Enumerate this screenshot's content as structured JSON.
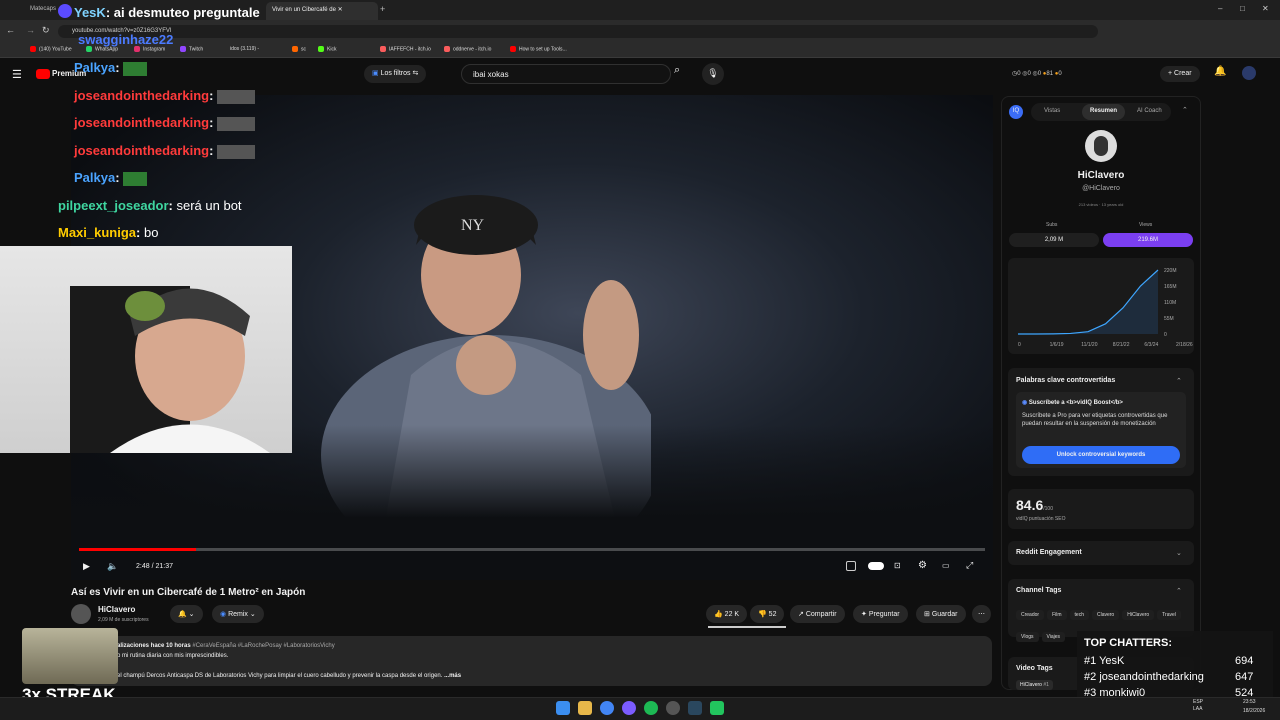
{
  "browser": {
    "tabs": [
      "Matecaps",
      "Vivir en un Cibercafé de"
    ],
    "url": "youtube.com/watch?v=z0Z16G3YFVI",
    "bookmarks": [
      "(140) YouTube",
      "WhatsApp",
      "Instagram",
      "Twitch",
      "idos (3.119) -",
      "sc",
      "Kick",
      "IAFFEFCH - itch.io",
      "oddnerve - itch.io",
      "How to set up Tools..."
    ]
  },
  "youtube": {
    "logo_label": "Premium",
    "filter_label": "Los filtros",
    "search_value": "ibai xokas",
    "create_label": "Crear",
    "header_stats": [
      "0",
      "0",
      "0",
      "81",
      "0"
    ]
  },
  "player": {
    "time": "2:48 / 21:37",
    "progress": 0.129
  },
  "video": {
    "title": "Así es Vivir en un Cibercafé de 1 Metro² en Japón",
    "channel": "HiClavero",
    "subs": "2,09 M de suscriptores",
    "remix_label": "Remix",
    "likes": "22 K",
    "dislikes": "52",
    "share_label": "Compartir",
    "ask_label": "Preguntar",
    "save_label": "Guardar",
    "desc_meta": "alizaciones  hace 10 horas",
    "desc_tags": "#CeraVeEspaña #LaRochePosay #LaboratoriosVichy",
    "desc_line1": "o mi rutina diaria con mis imprescindibles.",
    "desc_line2": "el champú Dercos Anticaspa DS de Laboratorios Vichy para limpiar el cuero cabelludo y prevenir la caspa desde el origen.",
    "desc_more": "...más"
  },
  "chat": [
    {
      "user": "YesK",
      "msg": "ai desmuteo preguntale",
      "color": "#7fd3ff"
    },
    {
      "user": "swagginhaze22",
      "msg": "",
      "color": "#4b7bff"
    },
    {
      "user": "Palkya",
      "msg": "",
      "color": "#4aa3ff"
    },
    {
      "user": "joseandointhedarking",
      "msg": "",
      "color": "#ff3b3b"
    },
    {
      "user": "joseandointhedarking",
      "msg": "",
      "color": "#ff3b3b"
    },
    {
      "user": "joseandointhedarking",
      "msg": "",
      "color": "#ff3b3b"
    },
    {
      "user": "Palkya",
      "msg": "",
      "color": "#4aa3ff"
    },
    {
      "user": "pilpeext_joseador",
      "msg": "será un bot",
      "color": "#3fd6a0"
    },
    {
      "user": "Maxi_kuniga",
      "msg": "bo",
      "color": "#ffcc00"
    }
  ],
  "streak": "3x STREAK",
  "top_chatters": {
    "title": "TOP CHATTERS:",
    "rows": [
      {
        "rank": "#1",
        "name": "YesK",
        "count": "694"
      },
      {
        "rank": "#2",
        "name": "joseandointhedarking",
        "count": "647"
      },
      {
        "rank": "#3",
        "name": "monkiwi0",
        "count": "524"
      }
    ]
  },
  "vidiq": {
    "tabs": [
      "Vistas",
      "Resumen",
      "AI Coach"
    ],
    "channel_name": "HiClavero",
    "handle": "@HiClavero",
    "meta": [
      "213 videos",
      "13 years old"
    ],
    "subs_label": "Subs",
    "views_label": "Views",
    "subs_value": "2,09 M",
    "views_value": "219.6M",
    "chart_data": {
      "type": "area",
      "x": [
        "0",
        "1/6/19",
        "11/1/20",
        "8/21/22",
        "6/3/24",
        "2/18/26"
      ],
      "yticks": [
        "220M",
        "165M",
        "110M",
        "55M",
        "0"
      ],
      "values": [
        0,
        0,
        0.5,
        2,
        8,
        35,
        90,
        165,
        220
      ],
      "ylim": [
        0,
        220
      ]
    },
    "controversial_title": "Palabras clave controvertidas",
    "boost_title": "Suscríbete a <b>vidIQ Boost</b>",
    "boost_text": "Suscríbete a Pro para ver etiquetas controvertidas que puedan resultar en la suspensión de monetización",
    "unlock_label": "Unlock controversial keywords",
    "seo_score": "84.6",
    "seo_max": "/100",
    "seo_label": "vidIQ puntuación SEO",
    "reddit_label": "Reddit Engagement",
    "channel_tags_label": "Channel Tags",
    "tags": [
      "Creador",
      "Film",
      "tech",
      "Clavero",
      "HiClavero",
      "Travel",
      "Vlogs",
      "Viajes"
    ],
    "video_tags_label": "Video Tags",
    "video_tag_first": "HiClavero",
    "video_tag_rank": "#1"
  },
  "taskbar": {
    "lang": "LAA",
    "lang2": "ESP",
    "time": "23:53",
    "date": "18/2/2026"
  }
}
